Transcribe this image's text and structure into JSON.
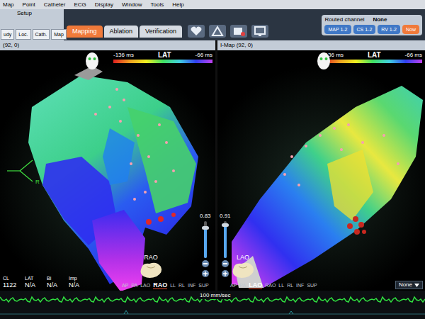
{
  "menu": [
    "Map",
    "Point",
    "Catheter",
    "ECG",
    "Display",
    "Window",
    "Tools",
    "Help"
  ],
  "setup_label": "Setup",
  "sub_tabs": [
    "udy",
    "Loc.",
    "Cath.",
    "Map"
  ],
  "mode_tabs": [
    {
      "label": "Mapping",
      "selected": true
    },
    {
      "label": "Ablation",
      "selected": false
    },
    {
      "label": "Verification",
      "selected": false
    }
  ],
  "routed_channel": {
    "label": "Routed channel",
    "value": "None"
  },
  "channel_buttons": [
    {
      "label": "MAP 1-2",
      "selected": false
    },
    {
      "label": "CS 1-2",
      "selected": false
    },
    {
      "label": "RV 1-2",
      "selected": false
    },
    {
      "label": "Now",
      "selected": true
    }
  ],
  "axis_label": "R",
  "maps": [
    {
      "title": "(92, 0)",
      "scale": {
        "min": "-136 ms",
        "label": "LAT",
        "max": "-66 ms"
      },
      "opacity": {
        "value": "0.83",
        "level": 0.83
      },
      "orientation": "RAO",
      "views": [
        {
          "label": "AP",
          "selected": false
        },
        {
          "label": "PA",
          "selected": false
        },
        {
          "label": "LAO",
          "selected": false
        },
        {
          "label": "RAO",
          "selected": true
        },
        {
          "label": "LL",
          "selected": false
        },
        {
          "label": "RL",
          "selected": false
        },
        {
          "label": "INF",
          "selected": false
        },
        {
          "label": "SUP",
          "selected": false
        }
      ]
    },
    {
      "title": "I-Map (92, 0)",
      "scale": {
        "min": "-136 ms",
        "label": "LAT",
        "max": "-66 ms"
      },
      "opacity": {
        "value": "0.91",
        "level": 0.91
      },
      "orientation": "LAO",
      "views": [
        {
          "label": "AP",
          "selected": false
        },
        {
          "label": "PA",
          "selected": false
        },
        {
          "label": "LAO",
          "selected": true
        },
        {
          "label": "RAO",
          "selected": false
        },
        {
          "label": "LL",
          "selected": false
        },
        {
          "label": "RL",
          "selected": false
        },
        {
          "label": "INF",
          "selected": false
        },
        {
          "label": "SUP",
          "selected": false
        }
      ]
    }
  ],
  "status": {
    "labels": [
      "CL",
      "LAT",
      "Bi",
      "Imp"
    ],
    "values": [
      "1122",
      "N/A",
      "N/A",
      "N/A"
    ]
  },
  "ecg": {
    "speed": "100 mm/sec"
  },
  "dropdown": {
    "value": "None"
  }
}
